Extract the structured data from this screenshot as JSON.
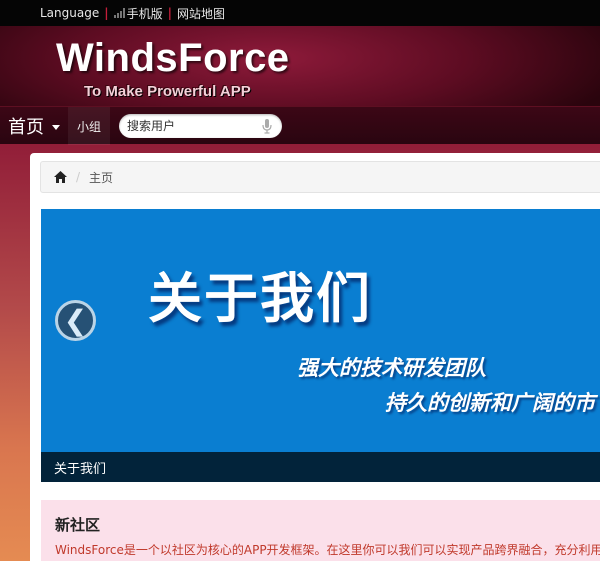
{
  "topbar": {
    "language": "Language",
    "mobile": "手机版",
    "sitemap": "网站地图"
  },
  "header": {
    "title": "WindsForce",
    "subtitle": "To Make Prowerful APP"
  },
  "nav": {
    "home": "首页",
    "group": "小组",
    "search_placeholder": "搜索用户"
  },
  "breadcrumb": {
    "current": "主页"
  },
  "carousel": {
    "title": "关于我们",
    "line1": "强大的技术研发团队",
    "line2": "持久的创新和广阔的市",
    "caption": "关于我们",
    "prev_glyph": "❮"
  },
  "community": {
    "title": "新社区",
    "text": "WindsForce是一个以社区为核心的APP开发框架。在这里你可以我们可以实现产品跨界融合，充分利用A"
  },
  "colors": {
    "accent": "#c41e3a",
    "carousel_bg": "#0a7ed1",
    "community_bg": "#fbe0ea"
  }
}
